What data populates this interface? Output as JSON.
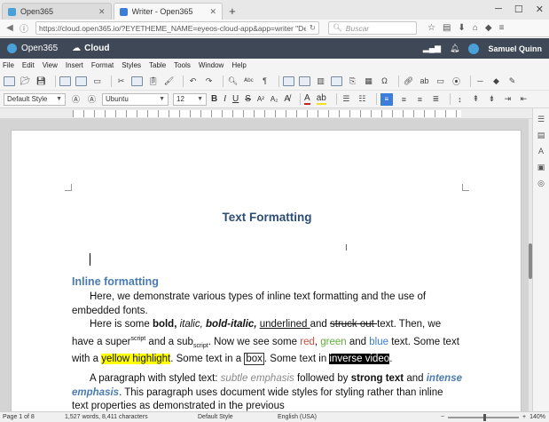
{
  "browser": {
    "tabs": [
      {
        "title": "Open365",
        "active": false,
        "favicon_color": "#4aa0d8"
      },
      {
        "title": "Writer - Open365",
        "active": true,
        "favicon_color": "#3b7dd8"
      }
    ],
    "new_tab": "+",
    "url": "https://cloud.open365.io/?EYETHEME_NAME=eyeos-cloud-app&app=writer \"Demo%2Fdemo.docx\"",
    "search_placeholder": "Buscar"
  },
  "app": {
    "brand": "Open365",
    "section": "Cloud",
    "user": "Samuel Quinn"
  },
  "menu": [
    "File",
    "Edit",
    "View",
    "Insert",
    "Format",
    "Styles",
    "Table",
    "Tools",
    "Window",
    "Help"
  ],
  "format_bar": {
    "paragraph_style": "Default Style",
    "font_name": "Ubuntu",
    "font_size": "12"
  },
  "document": {
    "title": "Text Formatting",
    "heading": "Inline formatting",
    "p1": "Here, we demonstrate various types of inline text formatting and the use of embedded fonts.",
    "p2": {
      "a": "Here is some ",
      "bold": "bold,",
      "sp1": " ",
      "italic": "italic,",
      "sp2": " ",
      "bolditalic": "bold-italic,",
      "sp3": " ",
      "underlined": "underlined ",
      "and1": "and ",
      "struck": "struck out ",
      "b": " text. Then, we have a super",
      "superscript": "script",
      "c": " and a sub",
      "subscript": "script",
      "d": ". Now we see some ",
      "red": "red",
      "comma": ", ",
      "green": "green",
      "and2": " and ",
      "blue": "blue",
      "e": " text. Some text with a ",
      "yellow": "yellow highlight",
      "f": ". Some text in a ",
      "box": "box",
      "g": ". Some text in ",
      "inverse": "inverse video",
      "h": "."
    },
    "p3": {
      "a": "A paragraph with styled text: ",
      "subtle": "subtle emphasis",
      "b": " followed by ",
      "strong": "strong text",
      "c": " and ",
      "intense": "intense emphasis",
      "d": ". This paragraph uses document wide styles for styling rather than inline text properties as demonstrated in the previous"
    }
  },
  "status": {
    "page": "Page 1 of 8",
    "words": "1,527 words, 8,411 characters",
    "style": "Default Style",
    "language": "English (USA)",
    "zoom": "140%",
    "zoom_level_percent": 140
  }
}
